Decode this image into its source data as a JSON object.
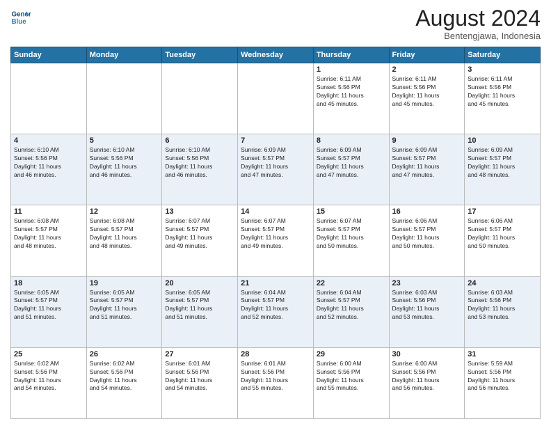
{
  "header": {
    "logo_line1": "General",
    "logo_line2": "Blue",
    "month_year": "August 2024",
    "location": "Bentengjawa, Indonesia"
  },
  "weekdays": [
    "Sunday",
    "Monday",
    "Tuesday",
    "Wednesday",
    "Thursday",
    "Friday",
    "Saturday"
  ],
  "weeks": [
    [
      {
        "day": "",
        "info": ""
      },
      {
        "day": "",
        "info": ""
      },
      {
        "day": "",
        "info": ""
      },
      {
        "day": "",
        "info": ""
      },
      {
        "day": "1",
        "info": "Sunrise: 6:11 AM\nSunset: 5:56 PM\nDaylight: 11 hours\nand 45 minutes."
      },
      {
        "day": "2",
        "info": "Sunrise: 6:11 AM\nSunset: 5:56 PM\nDaylight: 11 hours\nand 45 minutes."
      },
      {
        "day": "3",
        "info": "Sunrise: 6:11 AM\nSunset: 5:56 PM\nDaylight: 11 hours\nand 45 minutes."
      }
    ],
    [
      {
        "day": "4",
        "info": "Sunrise: 6:10 AM\nSunset: 5:56 PM\nDaylight: 11 hours\nand 46 minutes."
      },
      {
        "day": "5",
        "info": "Sunrise: 6:10 AM\nSunset: 5:56 PM\nDaylight: 11 hours\nand 46 minutes."
      },
      {
        "day": "6",
        "info": "Sunrise: 6:10 AM\nSunset: 5:56 PM\nDaylight: 11 hours\nand 46 minutes."
      },
      {
        "day": "7",
        "info": "Sunrise: 6:09 AM\nSunset: 5:57 PM\nDaylight: 11 hours\nand 47 minutes."
      },
      {
        "day": "8",
        "info": "Sunrise: 6:09 AM\nSunset: 5:57 PM\nDaylight: 11 hours\nand 47 minutes."
      },
      {
        "day": "9",
        "info": "Sunrise: 6:09 AM\nSunset: 5:57 PM\nDaylight: 11 hours\nand 47 minutes."
      },
      {
        "day": "10",
        "info": "Sunrise: 6:09 AM\nSunset: 5:57 PM\nDaylight: 11 hours\nand 48 minutes."
      }
    ],
    [
      {
        "day": "11",
        "info": "Sunrise: 6:08 AM\nSunset: 5:57 PM\nDaylight: 11 hours\nand 48 minutes."
      },
      {
        "day": "12",
        "info": "Sunrise: 6:08 AM\nSunset: 5:57 PM\nDaylight: 11 hours\nand 48 minutes."
      },
      {
        "day": "13",
        "info": "Sunrise: 6:07 AM\nSunset: 5:57 PM\nDaylight: 11 hours\nand 49 minutes."
      },
      {
        "day": "14",
        "info": "Sunrise: 6:07 AM\nSunset: 5:57 PM\nDaylight: 11 hours\nand 49 minutes."
      },
      {
        "day": "15",
        "info": "Sunrise: 6:07 AM\nSunset: 5:57 PM\nDaylight: 11 hours\nand 50 minutes."
      },
      {
        "day": "16",
        "info": "Sunrise: 6:06 AM\nSunset: 5:57 PM\nDaylight: 11 hours\nand 50 minutes."
      },
      {
        "day": "17",
        "info": "Sunrise: 6:06 AM\nSunset: 5:57 PM\nDaylight: 11 hours\nand 50 minutes."
      }
    ],
    [
      {
        "day": "18",
        "info": "Sunrise: 6:05 AM\nSunset: 5:57 PM\nDaylight: 11 hours\nand 51 minutes."
      },
      {
        "day": "19",
        "info": "Sunrise: 6:05 AM\nSunset: 5:57 PM\nDaylight: 11 hours\nand 51 minutes."
      },
      {
        "day": "20",
        "info": "Sunrise: 6:05 AM\nSunset: 5:57 PM\nDaylight: 11 hours\nand 51 minutes."
      },
      {
        "day": "21",
        "info": "Sunrise: 6:04 AM\nSunset: 5:57 PM\nDaylight: 11 hours\nand 52 minutes."
      },
      {
        "day": "22",
        "info": "Sunrise: 6:04 AM\nSunset: 5:57 PM\nDaylight: 11 hours\nand 52 minutes."
      },
      {
        "day": "23",
        "info": "Sunrise: 6:03 AM\nSunset: 5:56 PM\nDaylight: 11 hours\nand 53 minutes."
      },
      {
        "day": "24",
        "info": "Sunrise: 6:03 AM\nSunset: 5:56 PM\nDaylight: 11 hours\nand 53 minutes."
      }
    ],
    [
      {
        "day": "25",
        "info": "Sunrise: 6:02 AM\nSunset: 5:56 PM\nDaylight: 11 hours\nand 54 minutes."
      },
      {
        "day": "26",
        "info": "Sunrise: 6:02 AM\nSunset: 5:56 PM\nDaylight: 11 hours\nand 54 minutes."
      },
      {
        "day": "27",
        "info": "Sunrise: 6:01 AM\nSunset: 5:56 PM\nDaylight: 11 hours\nand 54 minutes."
      },
      {
        "day": "28",
        "info": "Sunrise: 6:01 AM\nSunset: 5:56 PM\nDaylight: 11 hours\nand 55 minutes."
      },
      {
        "day": "29",
        "info": "Sunrise: 6:00 AM\nSunset: 5:56 PM\nDaylight: 11 hours\nand 55 minutes."
      },
      {
        "day": "30",
        "info": "Sunrise: 6:00 AM\nSunset: 5:56 PM\nDaylight: 11 hours\nand 56 minutes."
      },
      {
        "day": "31",
        "info": "Sunrise: 5:59 AM\nSunset: 5:56 PM\nDaylight: 11 hours\nand 56 minutes."
      }
    ]
  ]
}
